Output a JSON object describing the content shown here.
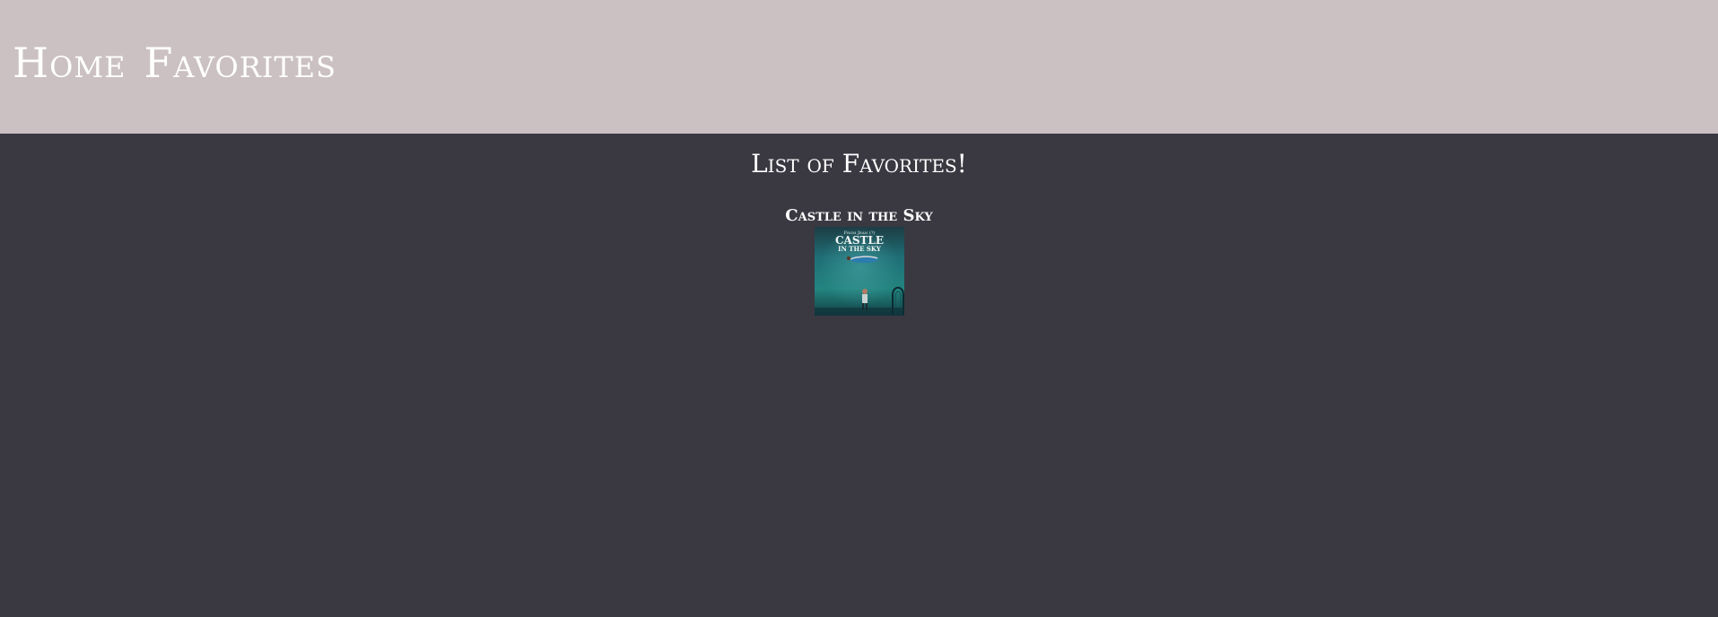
{
  "nav": {
    "home_label": "Home",
    "favorites_label": "Favorites"
  },
  "main": {
    "title": "List of Favorites!",
    "favorites": [
      {
        "title": "Castle in the Sky",
        "poster_text": {
          "top": "From Jean (?)",
          "line1": "CASTLE",
          "line2": "IN THE SKY"
        }
      }
    ]
  },
  "colors": {
    "header_bg": "#cbc1c2",
    "page_bg": "#3a3942",
    "text": "#ffffff"
  }
}
